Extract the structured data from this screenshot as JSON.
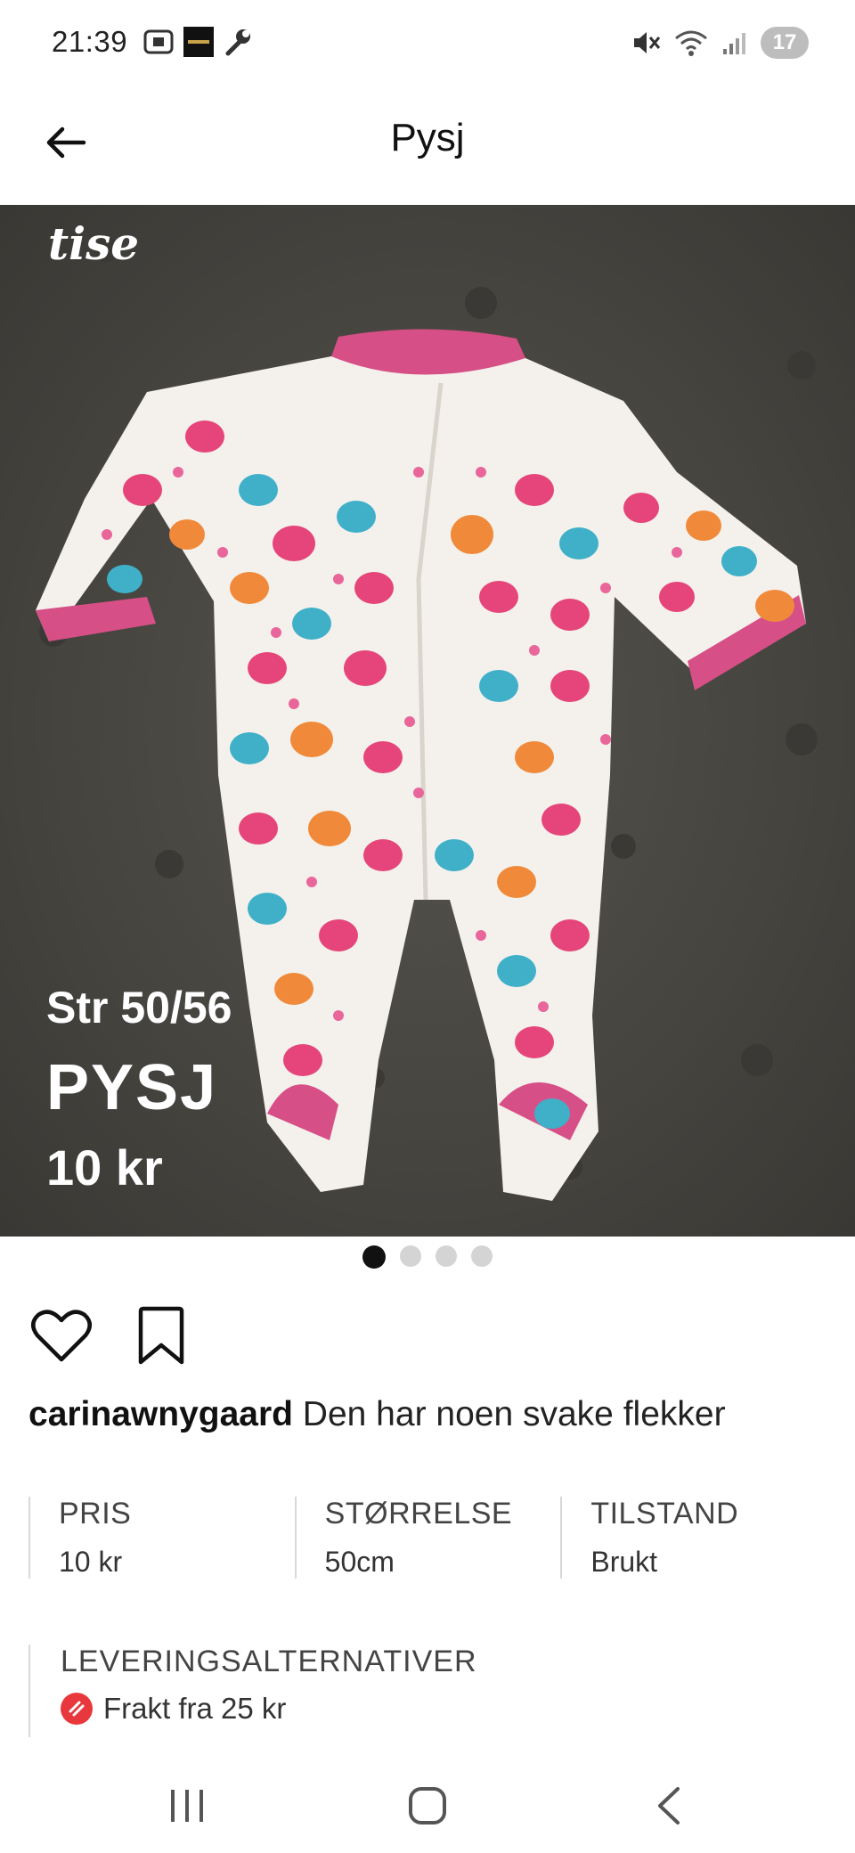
{
  "status_bar": {
    "time": "21:39",
    "left_icons": [
      "screenshot-icon",
      "app-thumbnail-icon",
      "wrench-icon"
    ],
    "right_icons": [
      "mute-icon",
      "wifi-icon",
      "signal-icon"
    ],
    "badge": "17"
  },
  "header": {
    "title": "Pysj",
    "back_icon": "arrow-left-icon"
  },
  "photo": {
    "logo": "tise",
    "size_text": "Str 50/56",
    "title_text": "PYSJ",
    "price_text": "10 kr",
    "pages": 4,
    "active_page": 1
  },
  "description": {
    "username": "carinawnygaard",
    "text": " Den har noen svake flekker"
  },
  "details": [
    {
      "label": "PRIS",
      "value": "10 kr"
    },
    {
      "label": "STØRRELSE",
      "value": "50cm"
    },
    {
      "label": "TILSTAND",
      "value": "Brukt"
    }
  ],
  "delivery": {
    "label": "LEVERINGSALTERNATIVER",
    "option": "Frakt fra 25 kr"
  },
  "colors": {
    "background": "#ffffff",
    "text": "#111111",
    "shipping_accent": "#e8383d",
    "photo_bg": "#4a4843",
    "garment": "#f4f1ec",
    "garment_trim": "#d64f86"
  }
}
